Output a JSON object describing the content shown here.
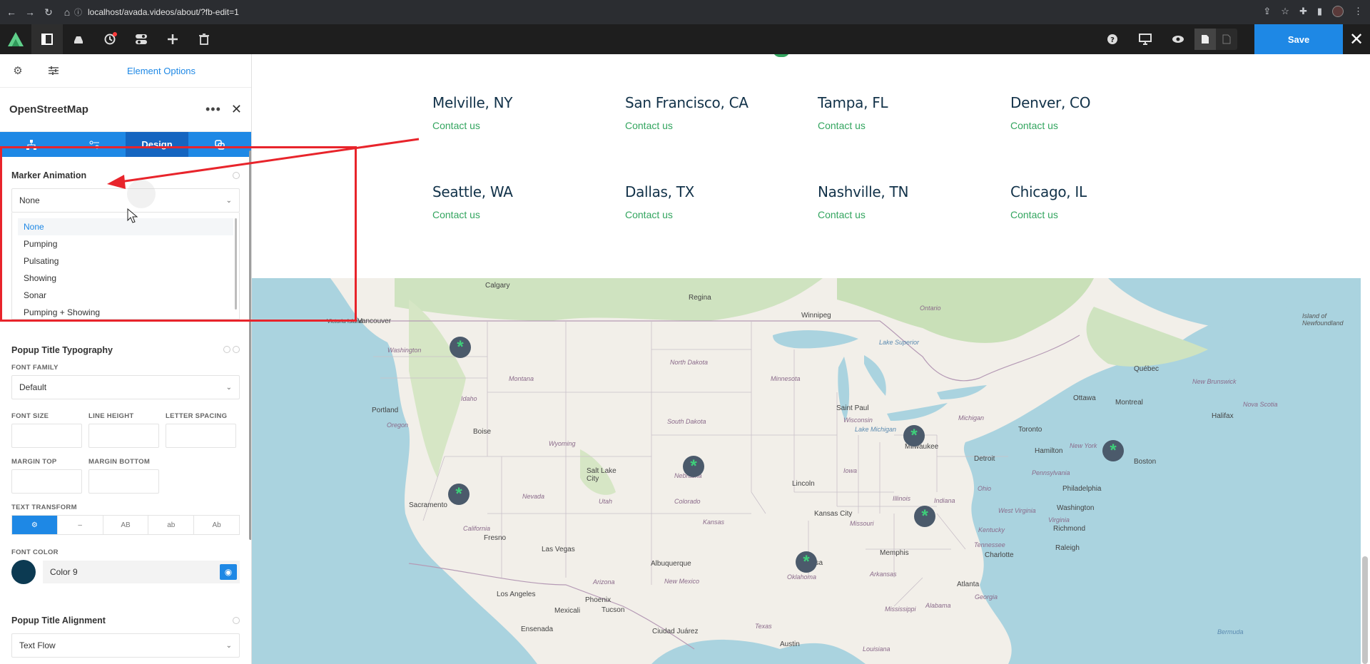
{
  "browser": {
    "url": "localhost/avada.videos/about/?fb-edit=1"
  },
  "toolbar": {
    "save_label": "Save"
  },
  "sidebar": {
    "panel_title": "Element Options",
    "element_name": "OpenStreetMap",
    "sub_tabs": [
      "",
      "",
      "Design",
      ""
    ],
    "marker_animation": {
      "label": "Marker Animation",
      "selected": "None",
      "options": [
        "None",
        "Pumping",
        "Pulsating",
        "Showing",
        "Sonar",
        "Pumping + Showing"
      ]
    },
    "popup_title_typography": {
      "label": "Popup Title Typography",
      "font_family_label": "FONT FAMILY",
      "font_family_value": "Default",
      "font_size_label": "FONT SIZE",
      "line_height_label": "LINE HEIGHT",
      "letter_spacing_label": "LETTER SPACING",
      "margin_top_label": "MARGIN TOP",
      "margin_bottom_label": "MARGIN BOTTOM",
      "text_transform_label": "TEXT TRANSFORM",
      "text_transform_options": [
        "",
        "–",
        "AB",
        "ab",
        "Ab"
      ],
      "font_color_label": "FONT COLOR",
      "font_color_value": "Color 9",
      "font_color_swatch": "#0c3a52"
    },
    "popup_title_alignment": {
      "label": "Popup Title Alignment",
      "value": "Text Flow"
    }
  },
  "locations": [
    {
      "city": "Melville, NY",
      "link": "Contact us"
    },
    {
      "city": "San Francisco, CA",
      "link": "Contact us"
    },
    {
      "city": "Tampa, FL",
      "link": "Contact us"
    },
    {
      "city": "Denver, CO",
      "link": "Contact us"
    },
    {
      "city": "Seattle, WA",
      "link": "Contact us"
    },
    {
      "city": "Dallas, TX",
      "link": "Contact us"
    },
    {
      "city": "Nashville, TN",
      "link": "Contact us"
    },
    {
      "city": "Chicago, IL",
      "link": "Contact us"
    }
  ],
  "map": {
    "cities": [
      "Calgary",
      "Regina",
      "Winnipeg",
      "Vancouver",
      "Portland",
      "Boise",
      "Salt Lake City",
      "Sacramento",
      "Fresno",
      "Las Vegas",
      "Los Angeles",
      "Phoenix",
      "Tucson",
      "Albuquerque",
      "Mexicali",
      "Ensenada",
      "Ciudad Juárez",
      "Austin",
      "Tulsa",
      "Kansas City",
      "Lincoln",
      "Saint Paul",
      "Milwaukee",
      "Detroit",
      "Toronto",
      "Hamilton",
      "Ottawa",
      "Montreal",
      "Québec",
      "Halifax",
      "Boston",
      "Philadelphia",
      "Washington",
      "Richmond",
      "Raleigh",
      "Charlotte",
      "Atlanta",
      "Memphis",
      "Bermuda",
      "Victoria Island"
    ],
    "regions": [
      "Washington",
      "Oregon",
      "Idaho",
      "Montana",
      "Wyoming",
      "North Dakota",
      "South Dakota",
      "Nebraska",
      "Kansas",
      "Minnesota",
      "Wisconsin",
      "Iowa",
      "Illinois",
      "Indiana",
      "Ohio",
      "Michigan",
      "Kentucky",
      "Tennessee",
      "Missouri",
      "Oklahoma",
      "Arkansas",
      "Texas",
      "Nevada",
      "Utah",
      "Colorado",
      "California",
      "Arizona",
      "New Mexico",
      "Pennsylvania",
      "New York",
      "West Virginia",
      "Virginia",
      "Georgia",
      "Alabama",
      "Mississippi",
      "Louisiana",
      "Ontario",
      "Island of Newfoundland",
      "New Brunswick",
      "Nova Scotia"
    ],
    "water": [
      "Lake Superior",
      "Lake Michigan"
    ]
  }
}
